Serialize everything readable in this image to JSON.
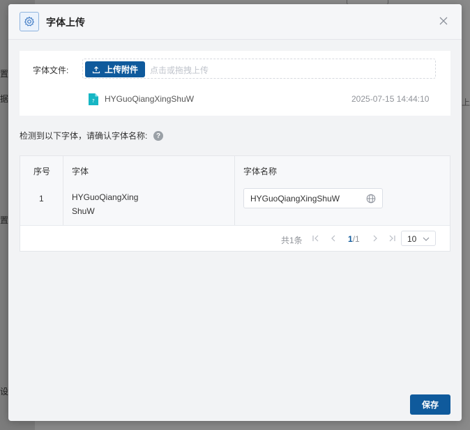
{
  "background": {
    "side_fragments": [
      "置",
      "据",
      "置",
      "设"
    ],
    "right_fragment": "上"
  },
  "dialog": {
    "title": "字体上传",
    "header_icon": "gear-icon",
    "close_icon": "close-icon"
  },
  "upload": {
    "label": "字体文件:",
    "button_label": "上传附件",
    "drop_hint": "点击或拖拽上传",
    "file": {
      "name": "HYGuoQiangXingShuW",
      "time": "2025-07-15 14:44:10",
      "icon": "file-icon"
    }
  },
  "detect": {
    "text": "检测到以下字体，请确认字体名称:",
    "help_icon": "?"
  },
  "table": {
    "headers": [
      "序号",
      "字体",
      "字体名称"
    ],
    "rows": [
      {
        "index": "1",
        "font_line1": "HYGuoQiangXing",
        "font_line2": "ShuW",
        "name_value": "HYGuoQiangXingShuW"
      }
    ]
  },
  "pager": {
    "total": "共1条",
    "current": "1",
    "total_pages": "/1",
    "page_size": "10"
  },
  "footer": {
    "save_label": "保存"
  },
  "colors": {
    "primary": "#0f5a9c",
    "overlay": "#7d7d7d",
    "dialog_bg": "#f2f3f5"
  }
}
